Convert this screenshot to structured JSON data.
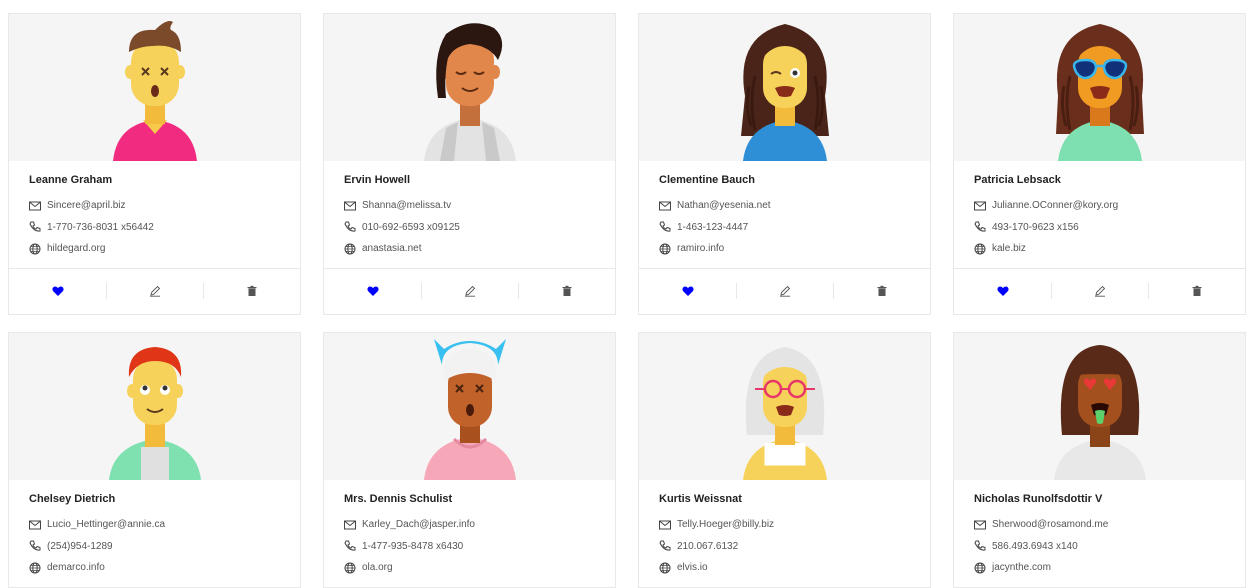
{
  "users": [
    {
      "name": "Leanne Graham",
      "email": "Sincere@april.biz",
      "phone": "1-770-736-8031 x56442",
      "website": "hildegard.org"
    },
    {
      "name": "Ervin Howell",
      "email": "Shanna@melissa.tv",
      "phone": "010-692-6593 x09125",
      "website": "anastasia.net"
    },
    {
      "name": "Clementine Bauch",
      "email": "Nathan@yesenia.net",
      "phone": "1-463-123-4447",
      "website": "ramiro.info"
    },
    {
      "name": "Patricia Lebsack",
      "email": "Julianne.OConner@kory.org",
      "phone": "493-170-9623 x156",
      "website": "kale.biz"
    },
    {
      "name": "Chelsey Dietrich",
      "email": "Lucio_Hettinger@annie.ca",
      "phone": "(254)954-1289",
      "website": "demarco.info"
    },
    {
      "name": "Mrs. Dennis Schulist",
      "email": "Karley_Dach@jasper.info",
      "phone": "1-477-935-8478 x6430",
      "website": "ola.org"
    },
    {
      "name": "Kurtis Weissnat",
      "email": "Telly.Hoeger@billy.biz",
      "phone": "210.067.6132",
      "website": "elvis.io"
    },
    {
      "name": "Nicholas Runolfsdottir V",
      "email": "Sherwood@rosamond.me",
      "phone": "586.493.6943 x140",
      "website": "jacynthe.com"
    }
  ],
  "colors": {
    "heart": "#0000ff",
    "icon": "#555555",
    "avatar_bg": "#f5f5f5"
  },
  "icons": {
    "email": "mail-icon",
    "phone": "phone-icon",
    "website": "globe-icon",
    "like": "heart-icon",
    "edit": "pencil-icon",
    "delete": "trash-icon"
  }
}
